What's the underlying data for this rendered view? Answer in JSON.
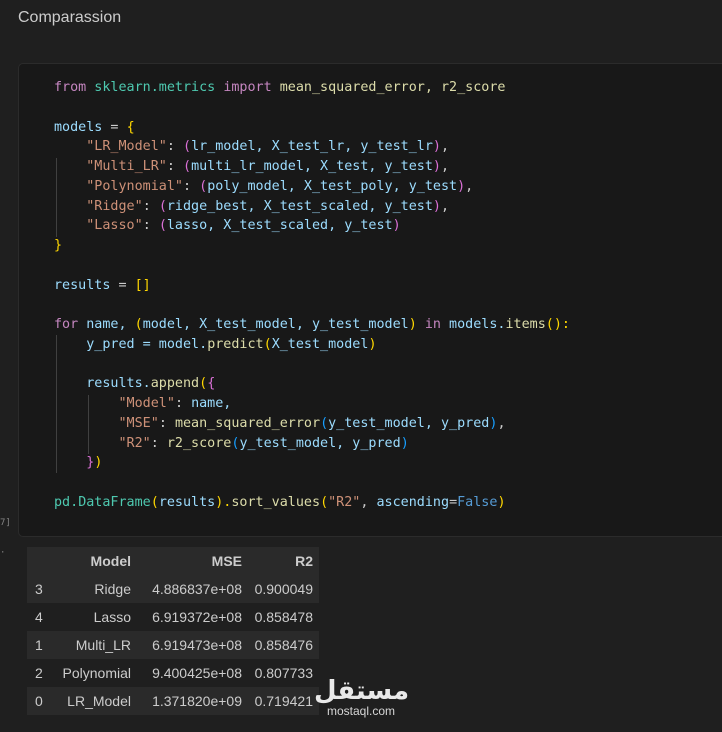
{
  "markdown": {
    "title": "Comparassion"
  },
  "code_cell": {
    "exec_count": "7]",
    "lines": [
      [
        [
          "from",
          "#c586c0"
        ],
        [
          " sklearn.metrics ",
          "#4ec9b0"
        ],
        [
          "import",
          "#c586c0"
        ],
        [
          " mean_squared_error, r2_score",
          "#dcdcaa"
        ]
      ],
      [],
      [
        [
          "models",
          "#9cdcfe"
        ],
        [
          " = ",
          "#cccccc"
        ],
        [
          "{",
          "#ffd700"
        ]
      ],
      [
        [
          "    ",
          "#cccccc"
        ],
        [
          "\"LR_Model\"",
          "#ce9178"
        ],
        [
          ": ",
          "#cccccc"
        ],
        [
          "(",
          "#da70d6"
        ],
        [
          "lr_model, X_test_lr, y_test_lr",
          "#9cdcfe"
        ],
        [
          ")",
          "#da70d6"
        ],
        [
          ",",
          "#cccccc"
        ]
      ],
      [
        [
          "    ",
          "#cccccc"
        ],
        [
          "\"Multi_LR\"",
          "#ce9178"
        ],
        [
          ": ",
          "#cccccc"
        ],
        [
          "(",
          "#da70d6"
        ],
        [
          "multi_lr_model, X_test, y_test",
          "#9cdcfe"
        ],
        [
          ")",
          "#da70d6"
        ],
        [
          ",",
          "#cccccc"
        ]
      ],
      [
        [
          "    ",
          "#cccccc"
        ],
        [
          "\"Polynomial\"",
          "#ce9178"
        ],
        [
          ": ",
          "#cccccc"
        ],
        [
          "(",
          "#da70d6"
        ],
        [
          "poly_model, X_test_poly, y_test",
          "#9cdcfe"
        ],
        [
          ")",
          "#da70d6"
        ],
        [
          ",",
          "#cccccc"
        ]
      ],
      [
        [
          "    ",
          "#cccccc"
        ],
        [
          "\"Ridge\"",
          "#ce9178"
        ],
        [
          ": ",
          "#cccccc"
        ],
        [
          "(",
          "#da70d6"
        ],
        [
          "ridge_best, X_test_scaled, y_test",
          "#9cdcfe"
        ],
        [
          ")",
          "#da70d6"
        ],
        [
          ",",
          "#cccccc"
        ]
      ],
      [
        [
          "    ",
          "#cccccc"
        ],
        [
          "\"Lasso\"",
          "#ce9178"
        ],
        [
          ": ",
          "#cccccc"
        ],
        [
          "(",
          "#da70d6"
        ],
        [
          "lasso, X_test_scaled, y_test",
          "#9cdcfe"
        ],
        [
          ")",
          "#da70d6"
        ]
      ],
      [
        [
          "}",
          "#ffd700"
        ]
      ],
      [],
      [
        [
          "results",
          "#9cdcfe"
        ],
        [
          " = ",
          "#cccccc"
        ],
        [
          "[]",
          "#ffd700"
        ]
      ],
      [],
      [
        [
          "for",
          "#c586c0"
        ],
        [
          " name, ",
          "#9cdcfe"
        ],
        [
          "(",
          "#ffd700"
        ],
        [
          "model, X_test_model, y_test_model",
          "#9cdcfe"
        ],
        [
          ")",
          "#ffd700"
        ],
        [
          " in ",
          "#c586c0"
        ],
        [
          "models.",
          "#9cdcfe"
        ],
        [
          "items",
          "#dcdcaa"
        ],
        [
          "():",
          "#ffd700"
        ]
      ],
      [
        [
          "    y_pred = model.",
          "#9cdcfe"
        ],
        [
          "predict",
          "#dcdcaa"
        ],
        [
          "(",
          "#ffd700"
        ],
        [
          "X_test_model",
          "#9cdcfe"
        ],
        [
          ")",
          "#ffd700"
        ]
      ],
      [],
      [
        [
          "    results.",
          "#9cdcfe"
        ],
        [
          "append",
          "#dcdcaa"
        ],
        [
          "(",
          "#ffd700"
        ],
        [
          "{",
          "#da70d6"
        ]
      ],
      [
        [
          "        ",
          "#cccccc"
        ],
        [
          "\"Model\"",
          "#ce9178"
        ],
        [
          ": ",
          "#cccccc"
        ],
        [
          "name,",
          "#9cdcfe"
        ]
      ],
      [
        [
          "        ",
          "#cccccc"
        ],
        [
          "\"MSE\"",
          "#ce9178"
        ],
        [
          ": ",
          "#cccccc"
        ],
        [
          "mean_squared_error",
          "#dcdcaa"
        ],
        [
          "(",
          "#179fff"
        ],
        [
          "y_test_model, y_pred",
          "#9cdcfe"
        ],
        [
          ")",
          "#179fff"
        ],
        [
          ",",
          "#cccccc"
        ]
      ],
      [
        [
          "        ",
          "#cccccc"
        ],
        [
          "\"R2\"",
          "#ce9178"
        ],
        [
          ": ",
          "#cccccc"
        ],
        [
          "r2_score",
          "#dcdcaa"
        ],
        [
          "(",
          "#179fff"
        ],
        [
          "y_test_model, y_pred",
          "#9cdcfe"
        ],
        [
          ")",
          "#179fff"
        ]
      ],
      [
        [
          "    ",
          "#cccccc"
        ],
        [
          "}",
          "#da70d6"
        ],
        [
          ")",
          "#ffd700"
        ]
      ],
      [],
      [
        [
          "pd.",
          "#4ec9b0"
        ],
        [
          "DataFrame",
          "#4ec9b0"
        ],
        [
          "(",
          "#ffd700"
        ],
        [
          "results",
          "#9cdcfe"
        ],
        [
          ").",
          "#ffd700"
        ],
        [
          "sort_values",
          "#dcdcaa"
        ],
        [
          "(",
          "#ffd700"
        ],
        [
          "\"R2\"",
          "#ce9178"
        ],
        [
          ", ",
          "#cccccc"
        ],
        [
          "ascending",
          "#9cdcfe"
        ],
        [
          "=",
          "#cccccc"
        ],
        [
          "False",
          "#569cd6"
        ],
        [
          ")",
          "#ffd700"
        ]
      ]
    ]
  },
  "output": {
    "marker": "·",
    "dataframe": {
      "columns": [
        "",
        "Model",
        "MSE",
        "R2"
      ],
      "rows": [
        [
          "3",
          "Ridge",
          "4.886837e+08",
          "0.900049"
        ],
        [
          "4",
          "Lasso",
          "6.919372e+08",
          "0.858478"
        ],
        [
          "1",
          "Multi_LR",
          "6.919473e+08",
          "0.858476"
        ],
        [
          "2",
          "Polynomial",
          "9.400425e+08",
          "0.807733"
        ],
        [
          "0",
          "LR_Model",
          "1.371820e+09",
          "0.719421"
        ]
      ]
    }
  },
  "watermark": {
    "arabic": "مستقل",
    "latin": "mostaql.com"
  }
}
